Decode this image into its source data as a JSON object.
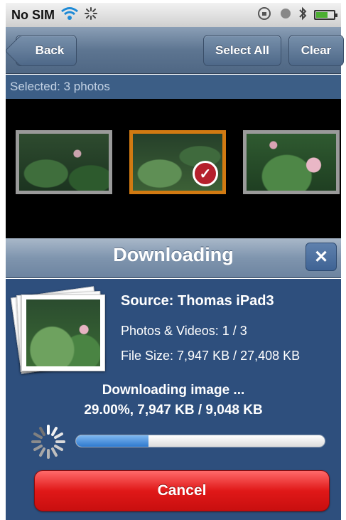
{
  "status_bar": {
    "carrier": "No SIM",
    "icons": [
      "wifi-icon",
      "activity-icon",
      "rotation-lock-icon",
      "location-icon",
      "bluetooth-icon",
      "battery-icon"
    ]
  },
  "nav": {
    "back_label": "Back",
    "select_all_label": "Select All",
    "clear_label": "Clear"
  },
  "selection": {
    "text": "Selected: 3 photos"
  },
  "thumbnails": [
    {
      "selected": false
    },
    {
      "selected": true
    },
    {
      "selected": false
    }
  ],
  "dialog": {
    "title": "Downloading",
    "source": "Source: Thomas iPad3",
    "photos_videos": "Photos & Videos: 1 / 3",
    "file_size": "File Size: 7,947 KB / 27,408 KB",
    "status": "Downloading image ...",
    "progress_text": "29.00%, 7,947 KB / 9,048 KB",
    "progress_fraction": 0.29,
    "cancel_label": "Cancel"
  },
  "colors": {
    "dialog_body": "#2e4f7d",
    "cancel_red": "#e01818",
    "selection_orange": "#d17a12"
  }
}
